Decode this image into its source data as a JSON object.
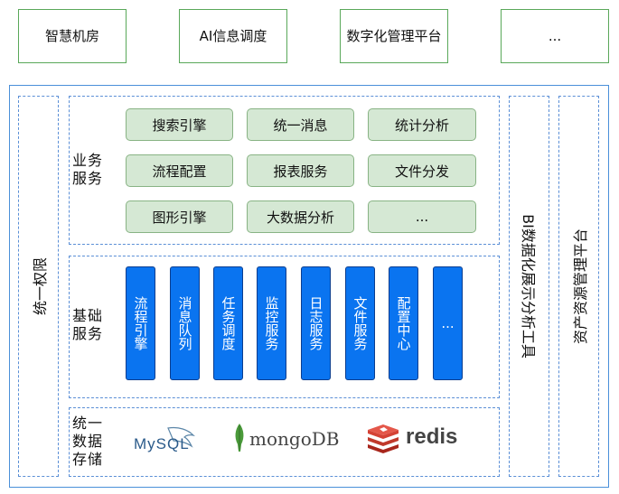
{
  "top_apps": [
    "智慧机房",
    "AI信息调度",
    "数字化管理平台",
    "..."
  ],
  "left_column": "统一权限",
  "right_columns": [
    "BI数据化展示分析工具",
    "资产资源管理平台"
  ],
  "business": {
    "label": "业务服务",
    "items": [
      "搜索引擎",
      "统一消息",
      "统计分析",
      "流程配置",
      "报表服务",
      "文件分发",
      "图形引擎",
      "大数据分析",
      "..."
    ]
  },
  "basic": {
    "label": "基础服务",
    "items": [
      "流程引擎",
      "消息队列",
      "任务调度",
      "监控服务",
      "日志服务",
      "文件服务",
      "配置中心",
      "..."
    ]
  },
  "storage": {
    "label": "统一数据存储",
    "logos": [
      "MySQL",
      "mongoDB",
      "redis"
    ]
  }
}
